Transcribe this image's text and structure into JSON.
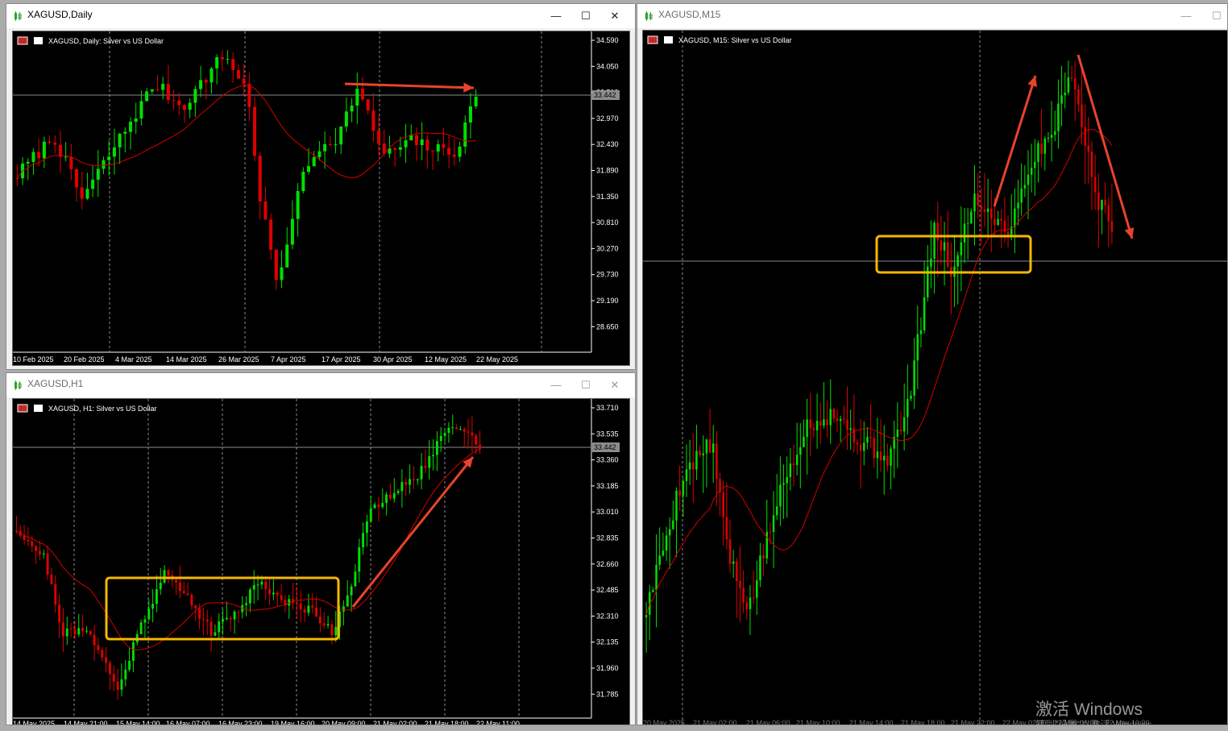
{
  "windows": {
    "daily": {
      "title": "XAGUSD,Daily",
      "header": "XAGUSD, Daily:  Silver vs US Dollar",
      "price_labels": [
        "34.590",
        "34.050",
        "33.510",
        "32.970",
        "32.430",
        "31.890",
        "31.350",
        "30.810",
        "30.270",
        "29.730",
        "29.190",
        "28.650"
      ],
      "date_labels": [
        "10 Feb 2025",
        "20 Feb 2025",
        "4 Mar 2025",
        "14 Mar 2025",
        "26 Mar 2025",
        "7 Apr 2025",
        "17 Apr 2025",
        "30 Apr 2025",
        "12 May 2025",
        "22 May 2025"
      ],
      "current_price": "33.442"
    },
    "h1": {
      "title": "XAGUSD,H1",
      "header": "XAGUSD, H1:  Silver vs US Dollar",
      "price_labels": [
        "33.710",
        "33.535",
        "33.360",
        "33.185",
        "33.010",
        "32.835",
        "32.660",
        "32.485",
        "32.310",
        "32.135",
        "31.960",
        "31.785"
      ],
      "date_labels": [
        "14 May 2025",
        "14 May 21:00",
        "15 May 14:00",
        "16 May 07:00",
        "16 May 23:00",
        "19 May 16:00",
        "20 May 09:00",
        "21 May 02:00",
        "21 May 18:00",
        "22 May 11:00"
      ],
      "current_price": "33.442"
    },
    "m15": {
      "title": "XAGUSD,M15",
      "header": "XAGUSD, M15:  Silver vs US Dollar",
      "date_labels": [
        "20 May 2025",
        "21 May 02:00",
        "21 May 06:00",
        "21 May 10:00",
        "21 May 14:00",
        "21 May 18:00",
        "21 May 22:00",
        "22 May 02:00",
        "22 May 06:00",
        "22 May 10:00"
      ]
    }
  },
  "colors": {
    "bull": "#00e000",
    "bear": "#e00000",
    "ma": "#d40000",
    "arrow": "#e8442a",
    "box": "#f5b800",
    "grid": "#8c8c8c"
  },
  "icons": [
    "chart-icon",
    "minimize-icon",
    "maximize-icon",
    "close-icon"
  ],
  "watermark": {
    "line1": "激活 Windows",
    "line2": "转到\"设置\"以激活 Windows。"
  }
}
